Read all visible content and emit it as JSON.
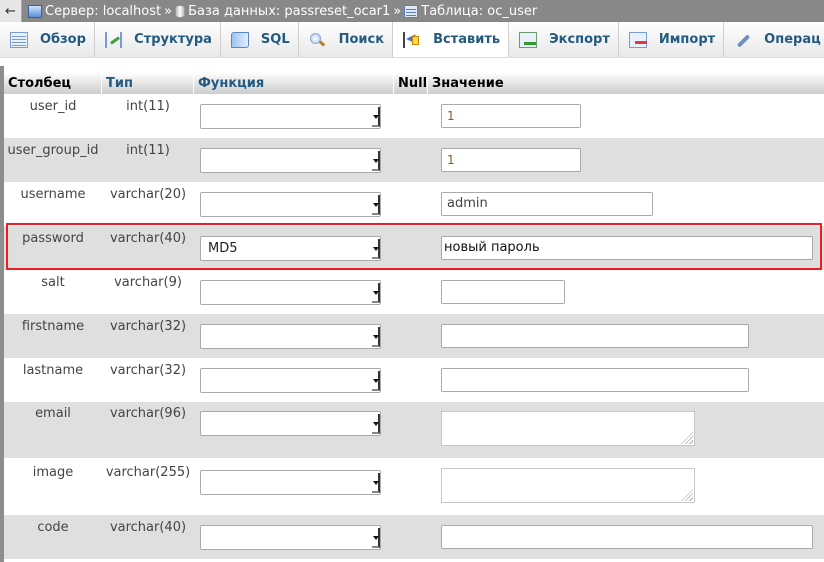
{
  "breadcrumb": {
    "back_label": "←",
    "items": [
      {
        "icon": "server-icon",
        "label": "Сервер: localhost"
      },
      {
        "icon": "database-icon",
        "label": "База данных: passreset_ocar1"
      },
      {
        "icon": "table-icon",
        "label": "Таблица: oc_user"
      }
    ],
    "separator": "»"
  },
  "tabs": [
    {
      "icon": "browse-icon",
      "label": "Обзор",
      "active": false
    },
    {
      "icon": "structure-icon",
      "label": "Структура",
      "active": false
    },
    {
      "icon": "sql-icon",
      "label": "SQL",
      "active": false
    },
    {
      "icon": "search-icon",
      "label": "Поиск",
      "active": false
    },
    {
      "icon": "insert-icon",
      "label": "Вставить",
      "active": true
    },
    {
      "icon": "export-icon",
      "label": "Экспорт",
      "active": false
    },
    {
      "icon": "import-icon",
      "label": "Импорт",
      "active": false
    },
    {
      "icon": "operations-icon",
      "label": "Операц",
      "active": false
    }
  ],
  "table": {
    "headers": {
      "column": "Столбец",
      "type": "Тип",
      "function": "Функция",
      "null": "Null",
      "value": "Значение"
    },
    "rows": [
      {
        "column": "user_id",
        "type": "int(11)",
        "function": "",
        "value": "1",
        "input": "text"
      },
      {
        "column": "user_group_id",
        "type": "int(11)",
        "function": "",
        "value": "1",
        "input": "text"
      },
      {
        "column": "username",
        "type": "varchar(20)",
        "function": "",
        "value": "admin",
        "input": "text"
      },
      {
        "column": "password",
        "type": "varchar(40)",
        "function": "MD5",
        "value": "новый пароль",
        "input": "text",
        "highlighted": true
      },
      {
        "column": "salt",
        "type": "varchar(9)",
        "function": "",
        "value": "",
        "input": "text"
      },
      {
        "column": "firstname",
        "type": "varchar(32)",
        "function": "",
        "value": "",
        "input": "text"
      },
      {
        "column": "lastname",
        "type": "varchar(32)",
        "function": "",
        "value": "",
        "input": "text"
      },
      {
        "column": "email",
        "type": "varchar(96)",
        "function": "",
        "value": "",
        "input": "textarea"
      },
      {
        "column": "image",
        "type": "varchar(255)",
        "function": "",
        "value": "",
        "input": "textarea"
      },
      {
        "column": "code",
        "type": "varchar(40)",
        "function": "",
        "value": "",
        "input": "text"
      }
    ]
  },
  "colors": {
    "highlight_border": "#ee1c24",
    "tab_text": "#235a81",
    "row_alt_bg": "#dfdfdf",
    "topbar_bg": "#888888"
  }
}
